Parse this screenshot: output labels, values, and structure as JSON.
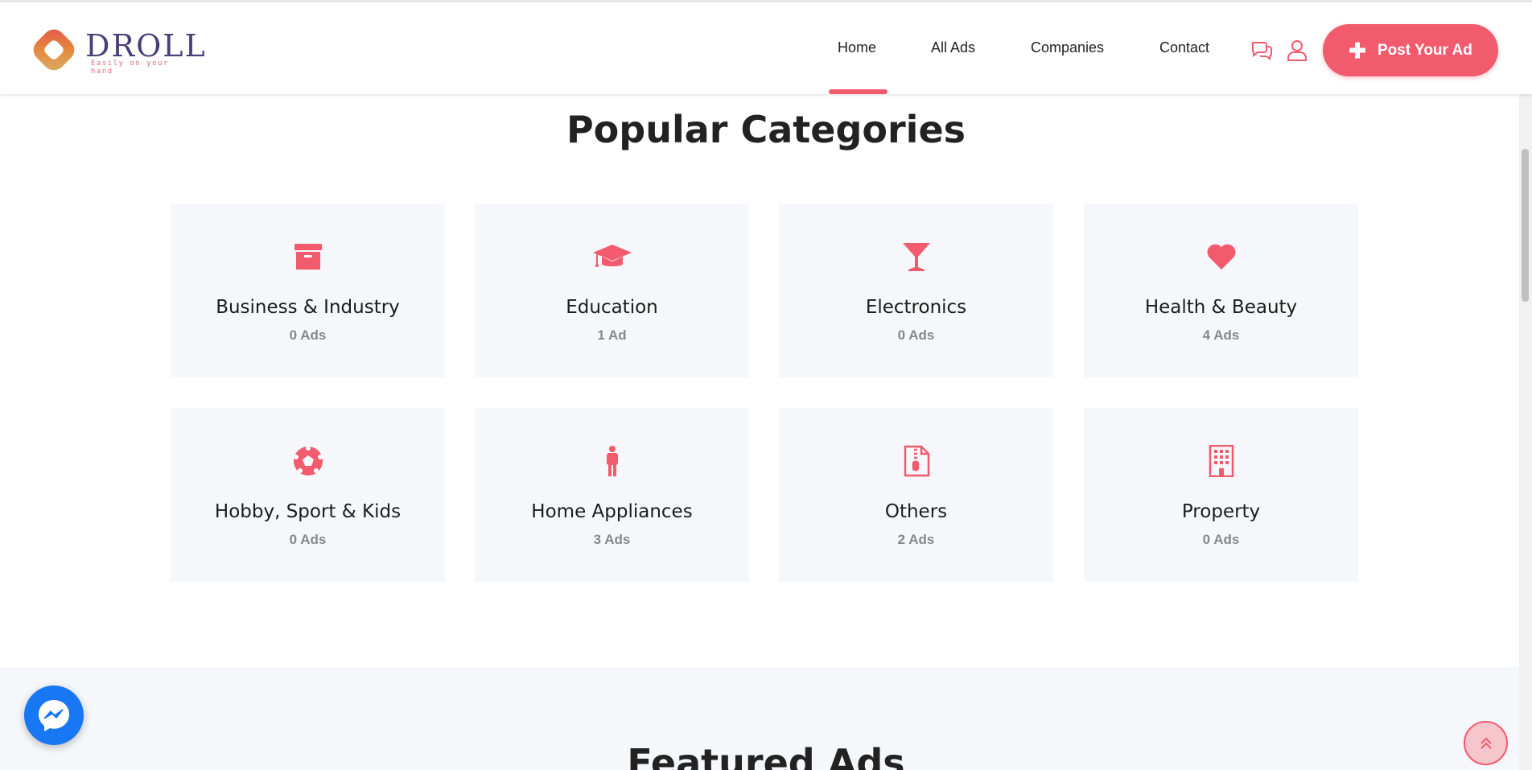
{
  "brand": {
    "name": "DROLL",
    "tagline": "Easily on your hand"
  },
  "nav": {
    "items": [
      {
        "label": "Home",
        "active": true
      },
      {
        "label": "All Ads",
        "active": false
      },
      {
        "label": "Companies",
        "active": false
      },
      {
        "label": "Contact",
        "active": false
      }
    ],
    "post_button_label": "Post Your Ad"
  },
  "colors": {
    "accent": "#f25a6e",
    "card_bg": "#f6f7fa",
    "messenger": "#1877f2"
  },
  "categories_section": {
    "title": "Popular Categories",
    "items": [
      {
        "name": "Business & Industry",
        "count": "0 Ads",
        "icon": "archive-box-icon"
      },
      {
        "name": "Education",
        "count": "1 Ad",
        "icon": "graduation-cap-icon"
      },
      {
        "name": "Electronics",
        "count": "0 Ads",
        "icon": "cocktail-glass-icon"
      },
      {
        "name": "Health & Beauty",
        "count": "4 Ads",
        "icon": "heart-icon"
      },
      {
        "name": "Hobby, Sport & Kids",
        "count": "0 Ads",
        "icon": "soccer-ball-icon"
      },
      {
        "name": "Home Appliances",
        "count": "3 Ads",
        "icon": "person-icon"
      },
      {
        "name": "Others",
        "count": "2 Ads",
        "icon": "zip-file-icon"
      },
      {
        "name": "Property",
        "count": "0 Ads",
        "icon": "building-icon"
      }
    ]
  },
  "featured_section": {
    "title": "Featured Ads"
  }
}
